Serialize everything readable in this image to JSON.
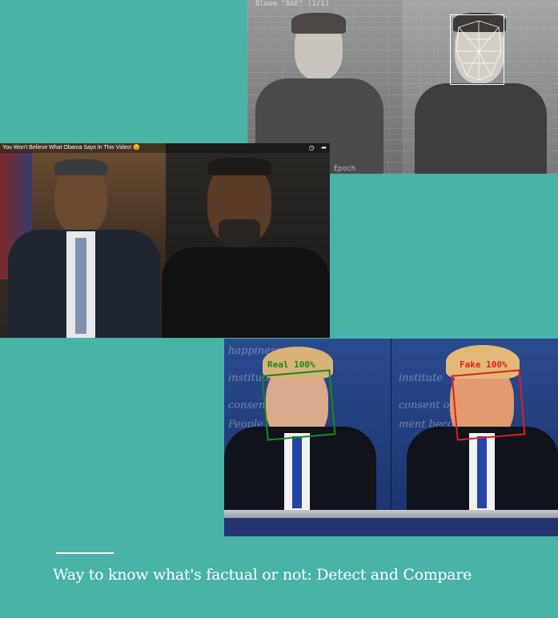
{
  "panels": {
    "top": {
      "overlay_label": "Bloom \"BAE\" (1/1)",
      "overlay_label_2": "Epoch"
    },
    "middle": {
      "video_title": "You Won't Believe What Obama Says In This Video! 😉",
      "icons": [
        "clock-icon",
        "share-icon"
      ],
      "icon_glyphs": {
        "clock": "◷",
        "share": "➦"
      }
    },
    "bottom": {
      "left_label": "Real 100%",
      "right_label": "Fake 100%",
      "background_script": [
        "happiness.",
        "institute",
        "consent of",
        "ment becom",
        "People"
      ],
      "colors": {
        "real": "#1a8a1a",
        "fake": "#e02020"
      }
    }
  },
  "caption": {
    "text": "Way to know what's factual or not: Detect and Compare"
  }
}
